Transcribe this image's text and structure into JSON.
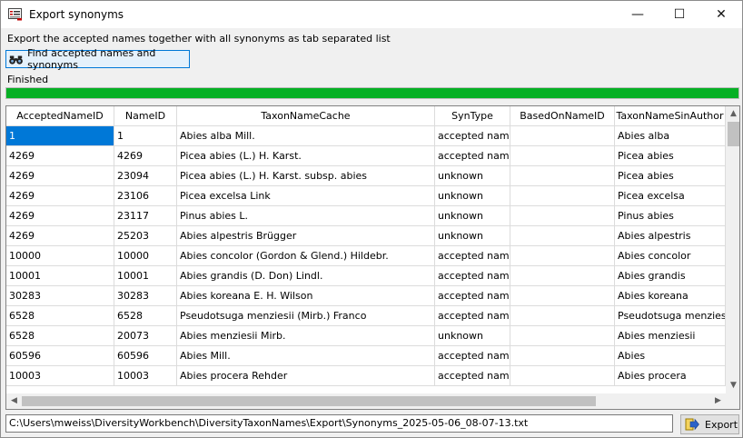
{
  "window": {
    "title": "Export synonyms",
    "icon": "export-list-icon"
  },
  "titlebar": {
    "minimize": "—",
    "maximize": "☐",
    "close": "✕"
  },
  "description": "Export the accepted names together with all synonyms as tab separated list",
  "find_button": {
    "label": "Find accepted names and synonyms",
    "icon": "binoculars-icon"
  },
  "status": "Finished",
  "progress": {
    "percent": 100,
    "color": "#06b025"
  },
  "grid": {
    "columns": [
      "AcceptedNameID",
      "NameID",
      "TaxonNameCache",
      "SynType",
      "BasedOnNameID",
      "TaxonNameSinAuthor"
    ],
    "rows": [
      [
        "1",
        "1",
        "Abies alba Mill.",
        "accepted name",
        "",
        "Abies alba"
      ],
      [
        "4269",
        "4269",
        "Picea abies (L.) H. Karst.",
        "accepted name",
        "",
        "Picea abies"
      ],
      [
        "4269",
        "23094",
        "Picea abies (L.) H. Karst. subsp. abies",
        "unknown",
        "",
        "Picea abies"
      ],
      [
        "4269",
        "23106",
        "Picea excelsa Link",
        "unknown",
        "",
        "Picea excelsa"
      ],
      [
        "4269",
        "23117",
        "Pinus abies L.",
        "unknown",
        "",
        "Pinus abies"
      ],
      [
        "4269",
        "25203",
        "Abies alpestris Brügger",
        "unknown",
        "",
        "Abies alpestris"
      ],
      [
        "10000",
        "10000",
        "Abies concolor (Gordon & Glend.) Hildebr.",
        "accepted name",
        "",
        "Abies concolor"
      ],
      [
        "10001",
        "10001",
        "Abies grandis (D. Don) Lindl.",
        "accepted name",
        "",
        "Abies grandis"
      ],
      [
        "30283",
        "30283",
        "Abies koreana E. H. Wilson",
        "accepted name",
        "",
        "Abies koreana"
      ],
      [
        "6528",
        "6528",
        "Pseudotsuga menziesii (Mirb.) Franco",
        "accepted name",
        "",
        "Pseudotsuga menziesii"
      ],
      [
        "6528",
        "20073",
        "Abies menziesii Mirb.",
        "unknown",
        "",
        "Abies menziesii"
      ],
      [
        "60596",
        "60596",
        "Abies Mill.",
        "accepted name",
        "",
        "Abies"
      ],
      [
        "10003",
        "10003",
        "Abies procera Rehder",
        "accepted name",
        "",
        "Abies procera"
      ]
    ],
    "selected_cell": "1"
  },
  "export": {
    "path": "C:\\Users\\mweiss\\DiversityWorkbench\\DiversityTaxonNames\\Export\\Synonyms_2025-05-06_08-07-13.txt",
    "button_label": "Export",
    "icon": "export-arrow-icon"
  }
}
